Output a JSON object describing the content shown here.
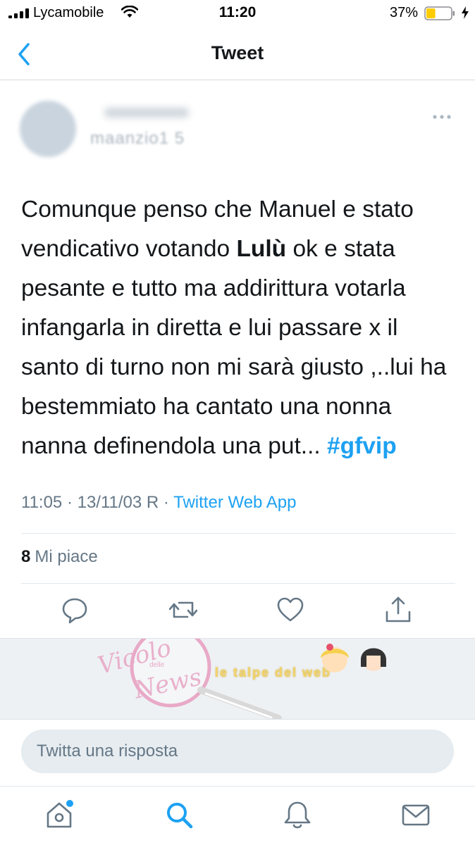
{
  "status_bar": {
    "carrier": "Lycamobile",
    "time": "11:20",
    "battery_percent": "37%",
    "battery_level": 0.37,
    "icons": [
      "signal-icon",
      "wifi-icon",
      "battery-icon",
      "charging-icon"
    ]
  },
  "nav": {
    "title": "Tweet",
    "back_icon": "chevron-left-icon"
  },
  "tweet": {
    "author_handle_visible": "maanzio1 5",
    "text_before": "Comunque penso che Manuel e stato vendicativo votando ",
    "text_bold": "Lulù",
    "text_after": " ok e stata pesante e tutto ma addirittura votarla infangarla in diretta e lui passare x il santo di turno non mi sarà giusto ,..lui ha bestemmiato ha cantato una nonna nanna definendola una put... ",
    "hashtag": "#gfvip",
    "meta_time": "11:05 · 13/11/03 R · ",
    "meta_source": "Twitter Web App",
    "likes_count": "8",
    "likes_label": "Mi piace",
    "actions": [
      "reply-icon",
      "retweet-icon",
      "like-icon",
      "share-icon"
    ],
    "more_icon": "more-icon"
  },
  "watermark": {
    "script_top": "Vicolo",
    "script_small": "delle",
    "script_bottom": "News",
    "site": "le talpe del web"
  },
  "reply": {
    "placeholder": "Twitta una risposta"
  },
  "tab_bar": {
    "items": [
      "home-icon",
      "search-icon",
      "notifications-icon",
      "messages-icon"
    ],
    "active": "search-icon",
    "home_has_badge": true
  },
  "colors": {
    "accent": "#1da1f2",
    "text": "#14171a",
    "secondary": "#657786",
    "battery": "#ffcc00"
  }
}
